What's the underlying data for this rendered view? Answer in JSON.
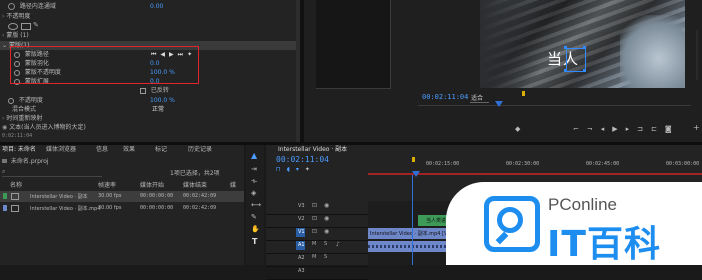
{
  "effect_controls": {
    "rows": [
      {
        "label": "路径内连通域",
        "value": "0.00"
      },
      {
        "label": "不透明度",
        "value": ""
      },
      {
        "label": "蒙版 (1)",
        "value": ""
      },
      {
        "label": "蒙版(1)",
        "value": ""
      },
      {
        "label": "蒙版路径",
        "value": ""
      },
      {
        "label": "蒙版羽化",
        "value": "0.0"
      },
      {
        "label": "蒙版不透明度",
        "value": "100.0 %"
      },
      {
        "label": "蒙版扩展",
        "value": "0.0"
      },
      {
        "label": "已反转",
        "value": ""
      },
      {
        "label": "不透明度",
        "value": "100.0 %"
      },
      {
        "label": "混合模式",
        "value": "正常"
      },
      {
        "label": "时间重新映射",
        "value": ""
      },
      {
        "label": "文本(当人员进入博物的大定)",
        "value": ""
      }
    ],
    "timecode": "0:02:11:04"
  },
  "program_monitor": {
    "overlay_text": "当人",
    "timecode": "00:02:11:04",
    "fit_label": "适合"
  },
  "project_panel": {
    "tabs": [
      "项目: 未命名",
      "媒体浏览器",
      "信息",
      "效果",
      "标记",
      "历史记录"
    ],
    "project_file": "未命名.prproj",
    "item_count": "1项已选择，共2项",
    "columns": [
      "名称",
      "帧速率",
      "媒体开始",
      "媒体结束",
      "媒"
    ],
    "items": [
      {
        "name": "Interstellar Video · 副本",
        "fps": "30.00 fps",
        "start": "00:00:00:00",
        "end": "00:02:42:09"
      },
      {
        "name": "Interstellar Video · 副本.mp4",
        "fps": "30.00 fps",
        "start": "00:00:00:00",
        "end": "00:02:42:09"
      }
    ]
  },
  "timeline": {
    "sequence_tab": "Interstellar Video · 副本",
    "timecode": "00:02:11:04",
    "ruler": [
      "00:02:15:00",
      "00:02:30:00",
      "00:02:45:00",
      "00:03:00:00"
    ],
    "tracks": [
      "V3",
      "V2",
      "V1",
      "A1",
      "A2",
      "A3"
    ],
    "title_clip": "当人类进入博物",
    "video_clip": "Interstellar Video · 副本.mp4 [V]"
  },
  "watermark": {
    "brand": "PConline",
    "cn": "IT百科"
  },
  "colors": {
    "accent": "#4a9cff",
    "highlight": "#e0262b",
    "playhead": "#2f6fd6",
    "clip_blue": "#6e87c9",
    "clip_green": "#3d9a57"
  }
}
